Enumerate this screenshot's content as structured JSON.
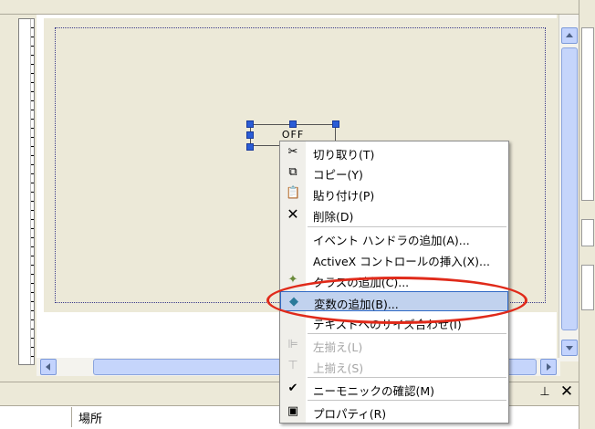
{
  "control": {
    "label": "OFF"
  },
  "context_menu": {
    "items": [
      {
        "label": "切り取り(T)",
        "icon": "scissors-icon",
        "enabled": true
      },
      {
        "label": "コピー(Y)",
        "icon": "copy-icon",
        "enabled": true
      },
      {
        "label": "貼り付け(P)",
        "icon": "paste-icon",
        "enabled": true
      },
      {
        "label": "削除(D)",
        "icon": "delete-icon",
        "enabled": true
      },
      {
        "label": "イベント ハンドラの追加(A)...",
        "icon": "",
        "enabled": true
      },
      {
        "label": "ActiveX コントロールの挿入(X)...",
        "icon": "",
        "enabled": true
      },
      {
        "label": "クラスの追加(C)...",
        "icon": "add-class-icon",
        "enabled": true
      },
      {
        "label": "変数の追加(B)...",
        "icon": "add-variable-icon",
        "enabled": true,
        "highlighted": true
      },
      {
        "label": "テキストへのサイズ合わせ(I)",
        "icon": "",
        "enabled": true
      },
      {
        "label": "左揃え(L)",
        "icon": "align-left-icon",
        "enabled": false
      },
      {
        "label": "上揃え(S)",
        "icon": "align-top-icon",
        "enabled": false
      },
      {
        "label": "ニーモニックの確認(M)",
        "icon": "check-mnemonic-icon",
        "enabled": true
      },
      {
        "label": "プロパティ(R)",
        "icon": "properties-icon",
        "enabled": true
      }
    ]
  },
  "bottom_panel": {
    "column_location": "場所"
  },
  "colors": {
    "highlight_ring": "#e02a1a",
    "menu_highlight": "#c1d2ee",
    "selection_handle": "#2a5cd6"
  }
}
